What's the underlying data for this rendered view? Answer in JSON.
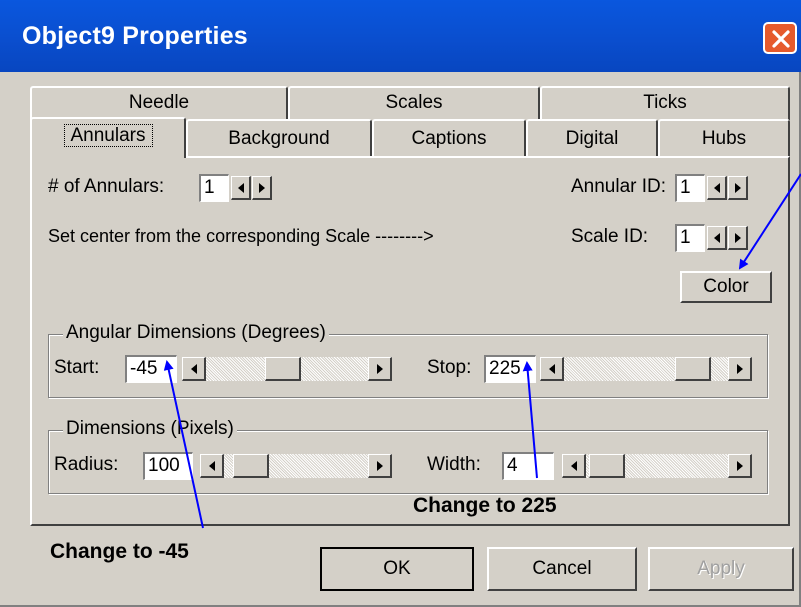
{
  "window": {
    "title": "Object9 Properties"
  },
  "tabs": {
    "row_back": [
      "Needle",
      "Scales",
      "Ticks"
    ],
    "row_front": [
      "Annulars",
      "Background",
      "Captions",
      "Digital",
      "Hubs"
    ],
    "active": "Annulars"
  },
  "annulars": {
    "num_label": "# of Annulars:",
    "num_value": "1",
    "annular_id_label": "Annular ID:",
    "annular_id_value": "1",
    "center_text": "Set center from the corresponding Scale -------->",
    "scale_id_label": "Scale ID:",
    "scale_id_value": "1",
    "color_button": "Color"
  },
  "angular_group": {
    "legend": "Angular Dimensions (Degrees)",
    "start_label": "Start:",
    "start_value": "-45",
    "start_position": 0.47,
    "stop_label": "Stop:",
    "stop_value": "225",
    "stop_position": 0.87
  },
  "dimension_group": {
    "legend": "Dimensions (Pixels)",
    "radius_label": "Radius:",
    "radius_value": "100",
    "radius_position": 0.08,
    "width_label": "Width:",
    "width_value": "4",
    "width_position": 0.03
  },
  "buttons": {
    "ok": "OK",
    "cancel": "Cancel",
    "apply": "Apply"
  },
  "annotations": {
    "start_note": "Change to -45",
    "stop_note": "Change to 225",
    "arrow_color": "#0000ff"
  },
  "colors": {
    "titlebar": "#0a4fd0",
    "face": "#d4d0c8",
    "close": "#e65a2c"
  }
}
